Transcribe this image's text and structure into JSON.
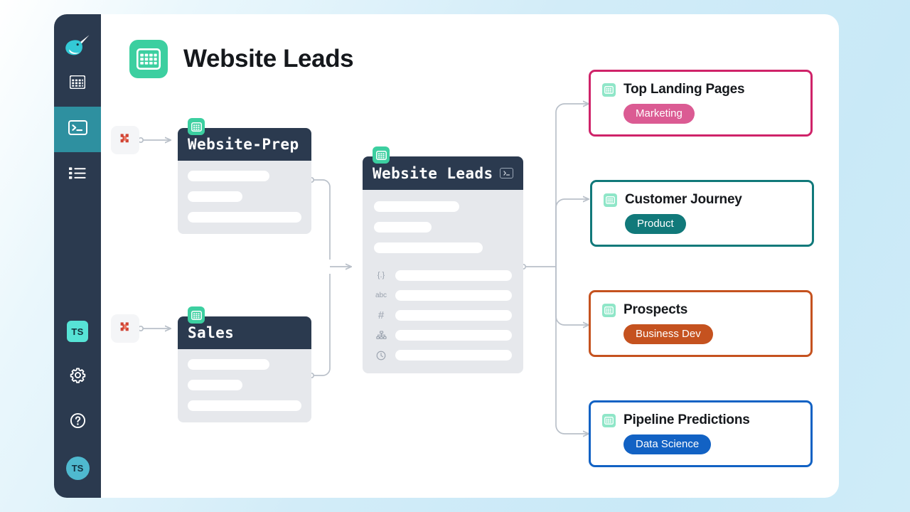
{
  "colors": {
    "background_start": "#ffffff",
    "background_end": "#c9e9f7",
    "sidebar_bg": "#2b3a4f",
    "sidebar_active": "#2e90a0",
    "panel_bg": "#ffffff",
    "node_header": "#2b3a4f",
    "node_body": "#e6e8ec",
    "grid_badge_green": "#3ccfa0",
    "edge_gray": "#b9c0c9",
    "source_icon_red": "#d04434",
    "marketing_pink": "#db5b93",
    "product_teal": "#11797a",
    "business_dev_orange": "#c5521f",
    "data_science_blue": "#1262c4"
  },
  "sidebar": {
    "logo": "narwhal-logo",
    "items": [
      {
        "icon": "grid-table-icon",
        "name": "tables",
        "active": false
      },
      {
        "icon": "terminal-icon",
        "name": "console",
        "active": true
      },
      {
        "icon": "list-icon",
        "name": "lists",
        "active": false
      }
    ],
    "bottom": {
      "workspace_badge": "TS",
      "settings_icon": "gear-icon",
      "help_icon": "question-circle-icon",
      "avatar_initials": "TS"
    }
  },
  "header": {
    "icon": "grid-table-icon",
    "title": "Website Leads"
  },
  "graph": {
    "source_nodes": [
      {
        "source_icon": "red-package-icon",
        "title": "Website-Prep",
        "badge_icon": "grid-table-icon",
        "bars": [
          {
            "width": "52%"
          },
          {
            "width": "34%"
          },
          {
            "width": "91%"
          }
        ]
      },
      {
        "source_icon": "red-package-icon",
        "title": "Sales",
        "badge_icon": "grid-table-icon",
        "bars": [
          {
            "width": "52%"
          },
          {
            "width": "34%"
          },
          {
            "width": "91%"
          }
        ]
      }
    ],
    "center_node": {
      "title": "Website Leads",
      "badge_icon": "grid-table-icon",
      "header_action_icon": "terminal-icon",
      "bars": [
        {
          "width": "44%"
        },
        {
          "width": "30%"
        },
        {
          "width": "80%"
        }
      ],
      "fields": [
        {
          "type_icon": "{.}",
          "type_name": "object-type-icon",
          "width": "100%"
        },
        {
          "type_icon": "abc",
          "type_name": "string-type-icon",
          "width": "100%"
        },
        {
          "type_icon": "#",
          "type_name": "number-type-icon",
          "width": "100%"
        },
        {
          "type_icon": "hierarchy",
          "type_name": "hierarchy-type-icon",
          "width": "100%"
        },
        {
          "type_icon": "clock",
          "type_name": "timestamp-type-icon",
          "width": "100%"
        }
      ]
    },
    "result_nodes": [
      {
        "title": "Top Landing Pages",
        "badge_icon": "grid-table-icon",
        "tag": "Marketing",
        "border_color": "#cf2369",
        "tag_color": "#db5b93"
      },
      {
        "title": "Customer Journey",
        "badge_icon": "grid-table-icon",
        "tag": "Product",
        "border_color": "#11797a",
        "tag_color": "#11797a"
      },
      {
        "title": "Prospects",
        "badge_icon": "grid-table-icon",
        "tag": "Business Dev",
        "border_color": "#c5521f",
        "tag_color": "#c5521f"
      },
      {
        "title": "Pipeline Predictions",
        "badge_icon": "grid-table-icon",
        "tag": "Data Science",
        "border_color": "#1262c4",
        "tag_color": "#1262c4"
      }
    ]
  }
}
